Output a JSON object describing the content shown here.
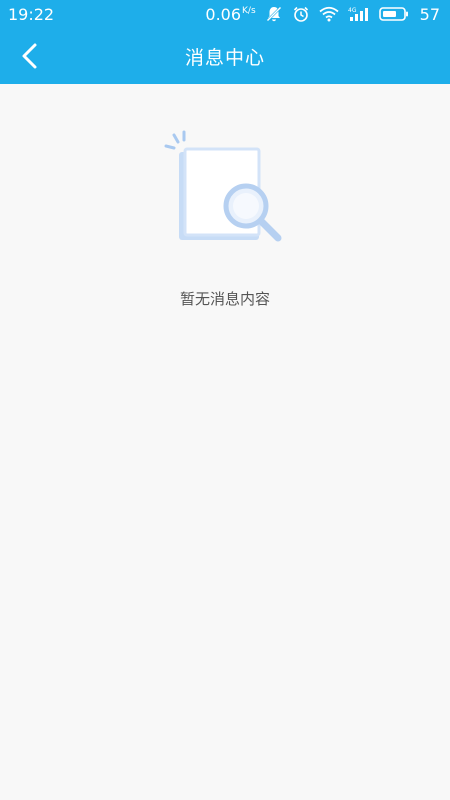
{
  "status_bar": {
    "time": "19:22",
    "net_speed": "0.06",
    "net_unit": "K/s",
    "battery_level": "57",
    "icons": [
      "notifications-off-icon",
      "alarm-icon",
      "wifi-icon",
      "4g-signal-icon",
      "battery-icon"
    ],
    "network_type": "4G"
  },
  "header": {
    "back_icon": "chevron-left-icon",
    "title": "消息中心"
  },
  "empty_state": {
    "illustration": "document-search-icon",
    "message": "暂无消息内容"
  },
  "colors": {
    "accent": "#1eaeea",
    "background": "#f8f8f8",
    "text_muted": "#555555"
  }
}
